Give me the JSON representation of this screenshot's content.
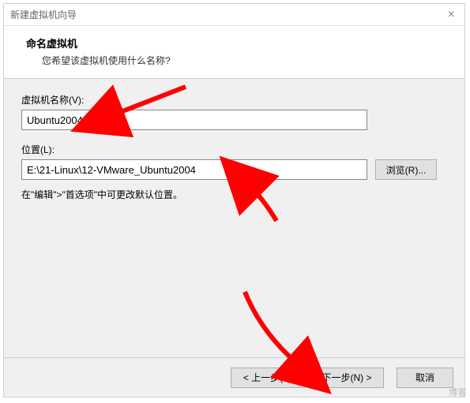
{
  "window": {
    "title": "新建虚拟机向导",
    "close_symbol": "×"
  },
  "header": {
    "title": "命名虚拟机",
    "subtitle": "您希望该虚拟机使用什么名称?"
  },
  "fields": {
    "name_label": "虚拟机名称(V):",
    "name_value": "Ubuntu2004",
    "location_label": "位置(L):",
    "location_value": "E:\\21-Linux\\12-VMware_Ubuntu2004",
    "browse_label": "浏览(R)..."
  },
  "pref_note": "在\"编辑\">\"首选项\"中可更改默认位置。",
  "footer": {
    "back": "< 上一步(B)",
    "next": "下一步(N) >",
    "cancel": "取消"
  },
  "watermark": "博客"
}
